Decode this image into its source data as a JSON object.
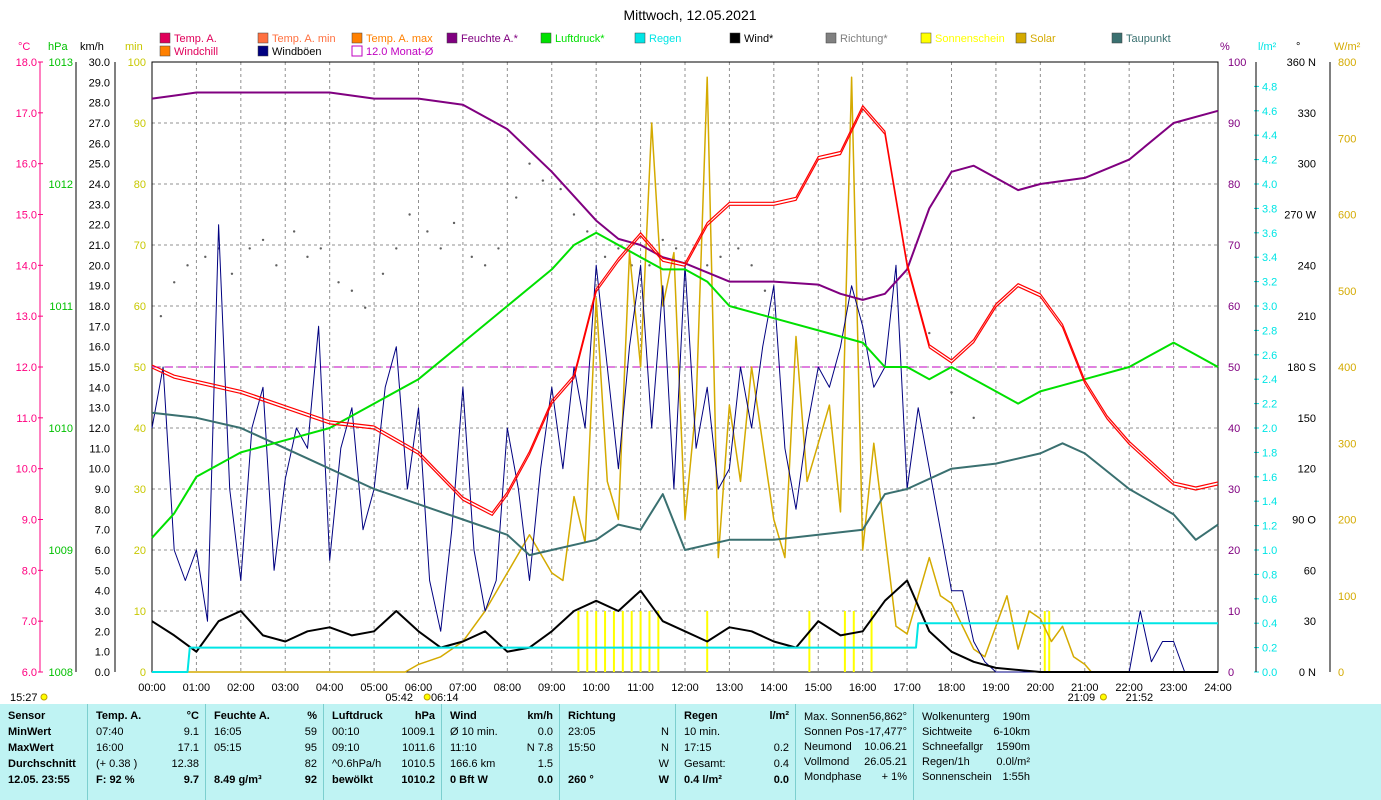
{
  "title": "Mittwoch, 12.05.2021",
  "legend": {
    "row1": [
      "Temp. A.",
      "Temp. A. min",
      "Temp. A. max",
      "Feuchte A.*",
      "Luftdruck*",
      "Regen",
      "Wind*",
      "Richtung*",
      "Sonnenschein",
      "Solar",
      "Taupunkt"
    ],
    "row2": [
      "Windchill",
      "Windböen",
      "12.0 Monat-Ø"
    ]
  },
  "axis_units": {
    "temp": "°C",
    "pressure": "hPa",
    "wind": "km/h",
    "sun_min": "min",
    "humidity": "%",
    "rain": "l/m²",
    "direction": "°",
    "solar": "W/m²"
  },
  "axis_ticks": {
    "temp": [
      "18.0",
      "17.0",
      "16.0",
      "15.0",
      "14.0",
      "13.0",
      "12.0",
      "11.0",
      "10.0",
      "9.0",
      "8.0",
      "7.0",
      "6.0"
    ],
    "pressure": [
      "1013",
      "1012",
      "1011",
      "1010",
      "1009",
      "1008"
    ],
    "wind": [
      "30.0",
      "29.0",
      "28.0",
      "27.0",
      "26.0",
      "25.0",
      "24.0",
      "23.0",
      "22.0",
      "21.0",
      "20.0",
      "19.0",
      "18.0",
      "17.0",
      "16.0",
      "15.0",
      "14.0",
      "13.0",
      "12.0",
      "11.0",
      "10.0",
      "9.0",
      "8.0",
      "7.0",
      "6.0",
      "5.0",
      "4.0",
      "3.0",
      "2.0",
      "1.0",
      "0.0"
    ],
    "sun_min": [
      "100",
      "90",
      "80",
      "70",
      "60",
      "50",
      "40",
      "30",
      "20",
      "10",
      "0"
    ],
    "humidity": [
      "100",
      "90",
      "80",
      "70",
      "60",
      "50",
      "40",
      "30",
      "20",
      "10",
      "0"
    ],
    "rain": [
      "4.8",
      "4.6",
      "4.4",
      "4.2",
      "4.0",
      "3.8",
      "3.6",
      "3.4",
      "3.2",
      "3.0",
      "2.8",
      "2.6",
      "2.4",
      "2.2",
      "2.0",
      "1.8",
      "1.6",
      "1.4",
      "1.2",
      "1.0",
      "0.8",
      "0.6",
      "0.4",
      "0.2",
      "0.0"
    ],
    "direction": [
      "360 N",
      "330",
      "300",
      "270 W",
      "240",
      "210",
      "180 S",
      "150",
      "120",
      "90 O",
      "60",
      "30",
      "0 N"
    ],
    "solar": [
      "800",
      "700",
      "600",
      "500",
      "400",
      "300",
      "200",
      "100",
      "0"
    ],
    "x": [
      "00:00",
      "01:00",
      "02:00",
      "03:00",
      "04:00",
      "05:00",
      "06:00",
      "07:00",
      "08:00",
      "09:00",
      "10:00",
      "11:00",
      "12:00",
      "13:00",
      "14:00",
      "15:00",
      "16:00",
      "17:00",
      "18:00",
      "19:00",
      "20:00",
      "21:00",
      "22:00",
      "23:00",
      "24:00"
    ]
  },
  "markers": {
    "sunrise_left": "15:27",
    "sunrise": "05:42",
    "sunrise2": "06:14",
    "sunset": "21:09",
    "sunset2": "21:52"
  },
  "colors": {
    "temp": "#ff0000",
    "humidity": "#800080",
    "pressure": "#00e000",
    "rain": "#00e5e5",
    "wind": "#000000",
    "gust": "#000080",
    "direction": "#808080",
    "sunshine": "#ffff00",
    "solar": "#d4aa00",
    "dewpoint": "#3a7070",
    "month_avg": "#c000c0",
    "temp_axis": "#ff0080",
    "pressure_axis": "#00c000",
    "sun_axis": "#c8c800",
    "panel_bg": "#bff3f3"
  },
  "chart_data": {
    "type": "line",
    "x_unit": "hour",
    "series": [
      {
        "name": "Temp. A.",
        "axis": "°C",
        "x": [
          0,
          0.5,
          1,
          2,
          3,
          4,
          5,
          6,
          7,
          7.66,
          8,
          8.5,
          9,
          9.5,
          10,
          10.5,
          11,
          11.5,
          12,
          12.5,
          13,
          13.5,
          14,
          14.5,
          15,
          15.5,
          16,
          16.5,
          17,
          17.5,
          18,
          18.5,
          19,
          19.5,
          20,
          20.5,
          21,
          21.5,
          22,
          22.5,
          23,
          23.5,
          24
        ],
        "y": [
          12.0,
          11.8,
          11.7,
          11.5,
          11.2,
          10.9,
          10.8,
          10.3,
          9.4,
          9.1,
          9.5,
          10.3,
          11.3,
          11.8,
          13.5,
          14.1,
          14.6,
          14.1,
          14.0,
          14.8,
          15.2,
          15.2,
          15.2,
          15.3,
          16.1,
          16.2,
          17.1,
          16.6,
          14.0,
          12.4,
          12.1,
          12.5,
          13.2,
          13.6,
          13.4,
          12.8,
          11.7,
          11.0,
          10.5,
          10.1,
          9.7,
          9.6,
          9.7
        ]
      },
      {
        "name": "Feuchte A.*",
        "axis": "%",
        "x": [
          0,
          0.5,
          1,
          2,
          3,
          4,
          5,
          6,
          7,
          8,
          9,
          10,
          10.5,
          11,
          11.5,
          12,
          13,
          14,
          15,
          15.5,
          16,
          16.5,
          17,
          17.5,
          18,
          18.5,
          19,
          19.5,
          20,
          21,
          22,
          23,
          24
        ],
        "y": [
          94,
          94.5,
          95,
          95,
          95,
          95,
          94,
          94,
          93,
          89,
          82,
          74,
          71,
          70,
          68,
          67,
          64,
          64,
          63.5,
          62,
          61,
          62,
          66,
          76,
          82,
          83,
          81,
          79,
          80,
          81,
          84,
          90,
          92
        ]
      },
      {
        "name": "Luftdruck*",
        "axis": "hPa",
        "x": [
          0,
          0.5,
          1,
          2,
          3,
          4,
          5,
          6,
          7,
          8,
          9,
          9.5,
          10,
          10.5,
          11,
          11.5,
          12,
          12.5,
          13,
          14,
          15,
          16,
          16.5,
          17,
          17.5,
          18,
          18.5,
          19,
          19.5,
          20,
          20.5,
          21,
          22,
          22.5,
          23,
          23.5,
          24
        ],
        "y": [
          1009.1,
          1009.3,
          1009.6,
          1009.8,
          1009.9,
          1010.0,
          1010.2,
          1010.4,
          1010.7,
          1011.0,
          1011.3,
          1011.5,
          1011.6,
          1011.5,
          1011.4,
          1011.3,
          1011.3,
          1011.2,
          1011.0,
          1010.9,
          1010.8,
          1010.7,
          1010.5,
          1010.5,
          1010.4,
          1010.5,
          1010.4,
          1010.3,
          1010.2,
          1010.3,
          1010.35,
          1010.4,
          1010.5,
          1010.6,
          1010.7,
          1010.6,
          1010.5
        ]
      },
      {
        "name": "Taupunkt",
        "axis": "°C",
        "x": [
          0,
          1,
          2,
          3,
          4,
          5,
          6,
          7,
          8,
          8.5,
          9,
          10,
          10.5,
          11,
          11.5,
          12,
          13,
          14,
          15,
          16,
          16.5,
          17,
          18,
          19,
          20,
          20.5,
          21,
          22,
          23,
          23.5,
          24
        ],
        "y": [
          11.1,
          11.0,
          10.8,
          10.4,
          10.0,
          9.6,
          9.3,
          9.0,
          8.7,
          8.3,
          8.4,
          8.6,
          8.9,
          8.8,
          9.5,
          8.4,
          8.6,
          8.6,
          8.7,
          8.8,
          9.5,
          9.6,
          10.0,
          10.1,
          10.3,
          10.5,
          10.3,
          9.6,
          9.1,
          8.6,
          8.9
        ]
      },
      {
        "name": "Wind*",
        "axis": "km/h",
        "x": [
          0,
          0.5,
          1,
          1.5,
          2,
          2.5,
          3,
          3.5,
          4,
          4.5,
          5,
          5.5,
          6,
          6.5,
          7,
          7.5,
          8,
          8.5,
          9,
          9.5,
          10,
          10.5,
          11,
          11.5,
          12,
          12.5,
          13,
          13.5,
          14,
          14.5,
          15,
          15.5,
          16,
          16.5,
          17,
          17.5,
          18,
          18.5,
          19,
          20,
          21,
          22,
          23,
          24
        ],
        "y": [
          2.5,
          1.8,
          1.0,
          2.5,
          3.0,
          1.8,
          1.5,
          2.0,
          2.2,
          1.8,
          2.0,
          3.0,
          2.0,
          1.2,
          1.5,
          2.0,
          1.0,
          1.2,
          2.0,
          3.0,
          3.5,
          3.0,
          4.0,
          2.5,
          2.0,
          1.5,
          2.2,
          2.0,
          1.5,
          1.2,
          2.5,
          1.8,
          2.0,
          3.5,
          4.5,
          2.0,
          1.0,
          0.5,
          0.2,
          0.0,
          0.0,
          0.0,
          0.0,
          0.0
        ]
      },
      {
        "name": "Windböen",
        "axis": "km/h",
        "x": [
          0,
          0.25,
          0.5,
          0.75,
          1,
          1.25,
          1.5,
          1.75,
          2,
          2.25,
          2.5,
          2.75,
          3,
          3.25,
          3.5,
          3.75,
          4,
          4.25,
          4.5,
          4.75,
          5,
          5.25,
          5.5,
          5.75,
          6,
          6.25,
          6.5,
          6.75,
          7,
          7.25,
          7.5,
          7.75,
          8,
          8.25,
          8.5,
          8.75,
          9,
          9.25,
          9.5,
          9.75,
          10,
          10.25,
          10.5,
          10.75,
          11,
          11.25,
          11.5,
          11.75,
          12,
          12.25,
          12.5,
          12.75,
          13,
          13.25,
          13.5,
          13.75,
          14,
          14.25,
          14.5,
          14.75,
          15,
          15.25,
          15.5,
          15.75,
          16,
          16.25,
          16.5,
          16.75,
          17,
          17.25,
          17.5,
          17.75,
          18,
          18.25,
          18.5,
          18.75,
          19,
          19.5,
          20,
          21,
          22,
          22.25,
          22.5,
          22.75,
          23,
          23.25,
          24
        ],
        "y": [
          12,
          15,
          6,
          4.5,
          6,
          2.5,
          22,
          9,
          4.5,
          12,
          14,
          5,
          9.5,
          12,
          11,
          17,
          5.5,
          11,
          13,
          7,
          9,
          14,
          16,
          9,
          13,
          4.5,
          2,
          7,
          14,
          6,
          3,
          4.5,
          12,
          9,
          4.5,
          10,
          14,
          10,
          15,
          12,
          20,
          15,
          10,
          16,
          20,
          12,
          19,
          9,
          20,
          11,
          14,
          9,
          10,
          15,
          12,
          16,
          19,
          11,
          8,
          12,
          15,
          14,
          16,
          19,
          17,
          14,
          15,
          20,
          9,
          13,
          10,
          7,
          4,
          4,
          1.5,
          0.5,
          0,
          0,
          0,
          0,
          0,
          3,
          0.5,
          1.5,
          1.5,
          0,
          0
        ]
      },
      {
        "name": "Richtung*",
        "axis": "°",
        "x": [
          0.2,
          0.5,
          0.8,
          1.2,
          1.5,
          1.8,
          2.2,
          2.5,
          2.8,
          3.2,
          3.5,
          3.8,
          4.2,
          4.5,
          4.8,
          5.2,
          5.5,
          5.8,
          6.2,
          6.5,
          6.8,
          7.2,
          7.5,
          7.8,
          8.2,
          8.5,
          8.8,
          9.2,
          9.5,
          9.8,
          10.2,
          10.5,
          10.8,
          11.2,
          11.5,
          11.8,
          12.2,
          12.5,
          12.8,
          13.2,
          13.5,
          13.8,
          17.5,
          18,
          18.5
        ],
        "y": [
          210,
          230,
          240,
          245,
          250,
          235,
          250,
          255,
          240,
          260,
          245,
          250,
          230,
          225,
          215,
          235,
          250,
          270,
          260,
          250,
          265,
          245,
          240,
          250,
          280,
          300,
          290,
          285,
          270,
          260,
          245,
          250,
          240,
          240,
          255,
          250,
          250,
          240,
          245,
          250,
          240,
          225,
          200,
          165,
          150
        ]
      },
      {
        "name": "Solar",
        "axis": "W/m²",
        "x": [
          0,
          5.7,
          6,
          6.5,
          7,
          7.5,
          8,
          8.5,
          9,
          9.25,
          9.5,
          9.75,
          10,
          10.25,
          10.5,
          10.75,
          11,
          11.25,
          11.5,
          11.75,
          12,
          12.25,
          12.5,
          12.75,
          13,
          13.25,
          13.5,
          13.75,
          14,
          14.25,
          14.5,
          14.75,
          15,
          15.25,
          15.5,
          15.75,
          16,
          16.25,
          16.5,
          16.75,
          17,
          17.25,
          17.5,
          17.75,
          18,
          18.25,
          18.5,
          18.75,
          19,
          19.25,
          19.5,
          19.75,
          20,
          20.25,
          20.5,
          20.75,
          21,
          21.15,
          24
        ],
        "y": [
          0,
          0,
          10,
          20,
          40,
          80,
          130,
          180,
          130,
          120,
          230,
          170,
          490,
          250,
          200,
          550,
          400,
          720,
          480,
          550,
          200,
          350,
          780,
          150,
          350,
          250,
          400,
          300,
          200,
          150,
          440,
          250,
          300,
          350,
          210,
          780,
          160,
          300,
          180,
          60,
          50,
          100,
          150,
          100,
          90,
          60,
          30,
          20,
          60,
          100,
          30,
          80,
          70,
          40,
          60,
          20,
          10,
          0,
          0
        ]
      },
      {
        "name": "Regen",
        "axis": "l/m²",
        "x": [
          0,
          0.8,
          0.85,
          17.2,
          17.25,
          24
        ],
        "y": [
          0,
          0,
          0.2,
          0.2,
          0.4,
          0.4
        ]
      },
      {
        "name": "Sonnenschein",
        "axis": "min",
        "x": [
          9.6,
          9.8,
          10.0,
          10.2,
          10.4,
          10.6,
          10.8,
          11.0,
          11.2,
          11.4,
          12.5,
          14.8,
          15.6,
          15.8,
          16.2,
          20.1,
          20.2
        ],
        "y": [
          5,
          5,
          5,
          5,
          5,
          5,
          5,
          5,
          5,
          5,
          5,
          5,
          5,
          5,
          5,
          5,
          5
        ]
      },
      {
        "name": "12.0 Monat-Ø",
        "axis": "°C",
        "x": [
          0,
          24
        ],
        "y": [
          12.0,
          12.0
        ]
      }
    ],
    "xlim": [
      0,
      24
    ],
    "ylims": {
      "temp": [
        6,
        18
      ],
      "pressure": [
        1008,
        1013
      ],
      "wind": [
        0,
        30
      ],
      "humidity": [
        0,
        100
      ],
      "rain": [
        0,
        5
      ],
      "direction": [
        0,
        360
      ],
      "solar": [
        0,
        800
      ],
      "sun_min": [
        0,
        100
      ]
    },
    "grid": true
  },
  "panel": {
    "sensor": {
      "header": "Sensor",
      "rows": [
        "MinWert",
        "MaxWert",
        "Durchschnitt",
        "12.05. 23:55"
      ]
    },
    "temp": {
      "header": "Temp. A.",
      "unit": "°C",
      "rows": [
        [
          "07:40",
          "9.1"
        ],
        [
          "16:00",
          "17.1"
        ],
        [
          "(+ 0.38 )",
          "12.38"
        ],
        [
          "F: 92 %",
          "9.7"
        ]
      ]
    },
    "humidity": {
      "header": "Feuchte A.",
      "unit": "%",
      "rows": [
        [
          "16:05",
          "59"
        ],
        [
          "05:15",
          "95"
        ],
        [
          "",
          "82"
        ],
        [
          "8.49 g/m³",
          "92"
        ]
      ]
    },
    "pressure": {
      "header": "Luftdruck",
      "unit": "hPa",
      "rows": [
        [
          "00:10",
          "1009.1"
        ],
        [
          "09:10",
          "1011.6"
        ],
        [
          "^0.6hPa/h",
          "1010.5"
        ],
        [
          "bewölkt",
          "1010.2"
        ]
      ]
    },
    "wind": {
      "header": "Wind",
      "unit": "km/h",
      "rows": [
        [
          "Ø 10 min.",
          "0.0"
        ],
        [
          "11:10",
          "N 7.8"
        ],
        [
          "166.6 km",
          "1.5"
        ],
        [
          "0 Bft W",
          "0.0"
        ]
      ]
    },
    "direction": {
      "header": "Richtung",
      "rows": [
        [
          "23:05",
          "N"
        ],
        [
          "15:50",
          "N"
        ],
        [
          "",
          "W"
        ],
        [
          "260 °",
          "W"
        ]
      ]
    },
    "rain": {
      "header": "Regen",
      "unit": "l/m²",
      "rows": [
        [
          "10 min.",
          ""
        ],
        [
          "17:15",
          "0.2"
        ],
        [
          "Gesamt:",
          "0.4"
        ],
        [
          "0.4 l/m²",
          "0.0"
        ]
      ]
    },
    "sun": {
      "rows": [
        [
          "Max. Sonnen",
          "56,862°"
        ],
        [
          "Sonnen Pos",
          "-17,477°"
        ],
        [
          "Neumond",
          "10.06.21"
        ],
        [
          "Vollmond",
          "26.05.21"
        ],
        [
          "Mondphase",
          "+ 1%"
        ]
      ]
    },
    "misc": {
      "rows": [
        [
          "Wolkenunterg",
          "190m"
        ],
        [
          "Sichtweite",
          "6-10km"
        ],
        [
          "Schneefallgr",
          "1590m"
        ],
        [
          "Regen/1h",
          "0.0l/m²"
        ],
        [
          "Sonnenschein",
          "1:55h"
        ]
      ]
    }
  }
}
